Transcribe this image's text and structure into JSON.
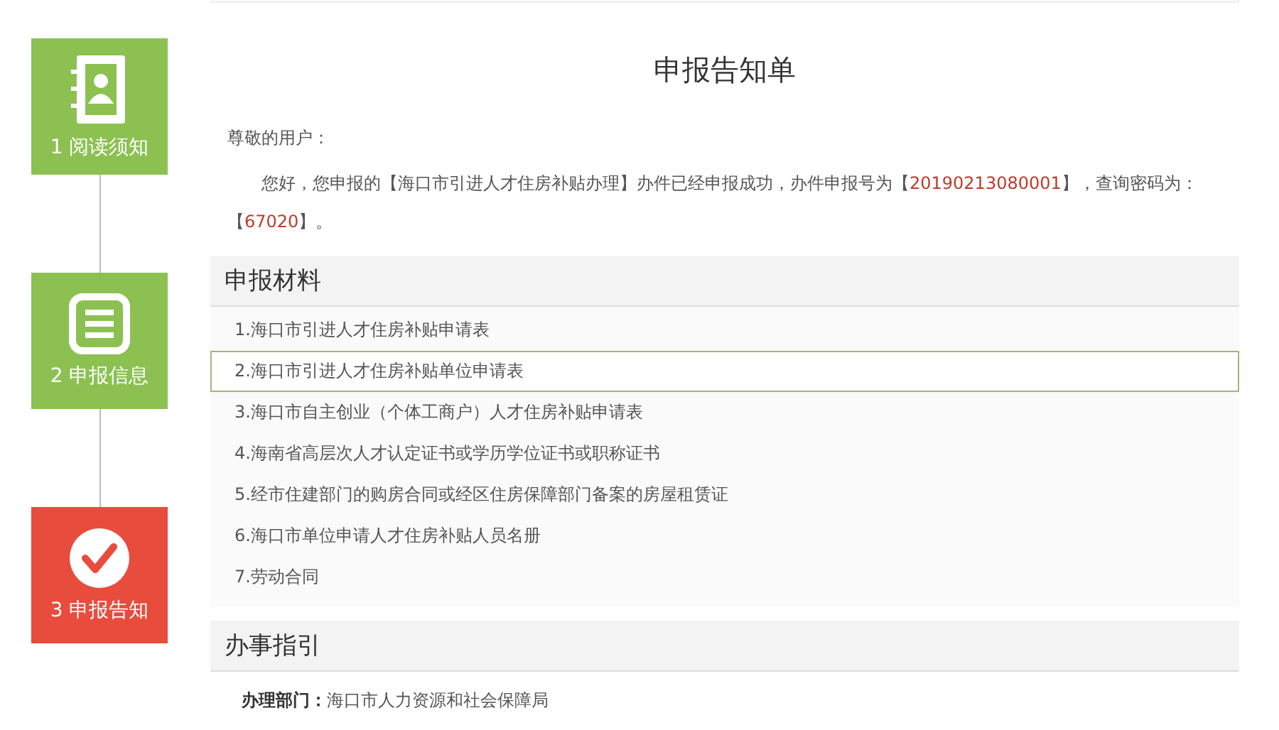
{
  "steps": [
    {
      "number": "1",
      "label": "阅读须知",
      "kind": "contact",
      "selected": false
    },
    {
      "number": "2",
      "label": "申报信息",
      "kind": "list",
      "selected": false
    },
    {
      "number": "3",
      "label": "申报告知",
      "kind": "check",
      "selected": true
    }
  ],
  "notice": {
    "title": "申报告知单",
    "greeting": "尊敬的用户：",
    "message": [
      {
        "text": "您好，您申报的【海口市引进人才住房补贴办理】办件已经申报成功，办件申报号为【",
        "highlight": false
      },
      {
        "text": "20190213080001",
        "highlight": true
      },
      {
        "text": "】，查询密码为：【",
        "highlight": false
      },
      {
        "text": "67020",
        "highlight": true
      },
      {
        "text": "】。",
        "highlight": false
      }
    ]
  },
  "materials": {
    "heading": "申报材料",
    "items": [
      {
        "text": "1.海口市引进人才住房补贴申请表",
        "selected": false
      },
      {
        "text": "2.海口市引进人才住房补贴单位申请表",
        "selected": true
      },
      {
        "text": "3.海口市自主创业（个体工商户）人才住房补贴申请表",
        "selected": false
      },
      {
        "text": "4.海南省高层次人才认定证书或学历学位证书或职称证书",
        "selected": false
      },
      {
        "text": "5.经市住建部门的购房合同或经区住房保障部门备案的房屋租赁证",
        "selected": false
      },
      {
        "text": "6.海口市单位申请人才住房补贴人员名册",
        "selected": false
      },
      {
        "text": "7.劳动合同",
        "selected": false
      }
    ]
  },
  "guide": {
    "heading": "办事指引",
    "fields": [
      {
        "label": "办理部门：",
        "value": "海口市人力资源和社会保障局"
      }
    ]
  }
}
